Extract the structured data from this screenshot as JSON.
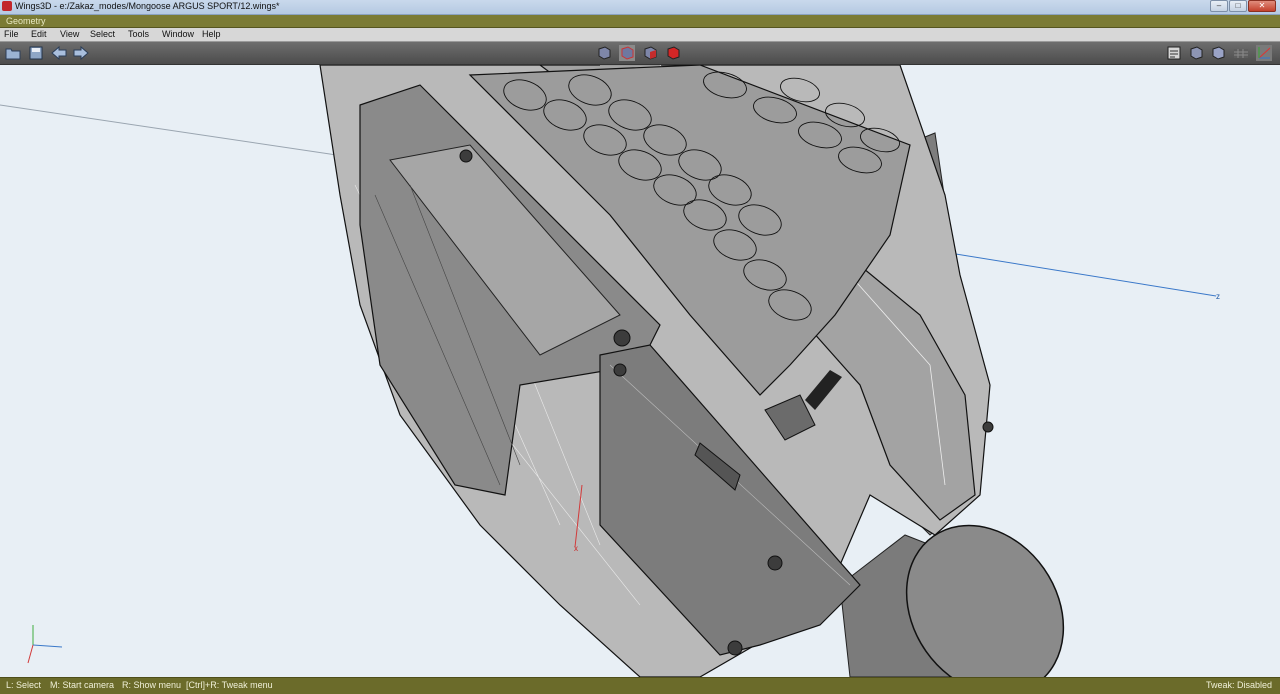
{
  "window": {
    "title": "Wings3D - e:/Zakaz_modes/Mongoose ARGUS SPORT/12.wings*",
    "minimize_glyph": "–",
    "maximize_glyph": "□",
    "close_glyph": "✕"
  },
  "geometry_bar": {
    "label": "Geometry"
  },
  "menu": [
    "File",
    "Edit",
    "View",
    "Select",
    "Tools",
    "Window",
    "Help"
  ],
  "toolbar": {
    "left_icons": [
      "open-folder-icon",
      "save-icon",
      "undo-arrow-icon",
      "redo-arrow-icon"
    ],
    "selection_modes": [
      "vertex-mode-icon",
      "edge-mode-icon",
      "face-mode-icon",
      "body-mode-icon"
    ],
    "right_icons": [
      "orthographic-icon",
      "wireframe-icon",
      "smooth-shade-icon",
      "ground-plane-icon",
      "axes-icon"
    ]
  },
  "viewport": {
    "axis_labels": {
      "z": "z",
      "x": "x"
    },
    "colors": {
      "background": "#e8eff5",
      "model": "#8d8d8d",
      "axis_z": "#3a78c9",
      "axis_x": "#d23a3a",
      "axis_y": "#3fae3f"
    }
  },
  "status": {
    "hint_select": "L: Select",
    "hint_camera": "M: Start camera",
    "hint_menu": "R: Show menu",
    "hint_tweak": "[Ctrl]+R: Tweak menu",
    "tweak_state": "Tweak: Disabled"
  }
}
